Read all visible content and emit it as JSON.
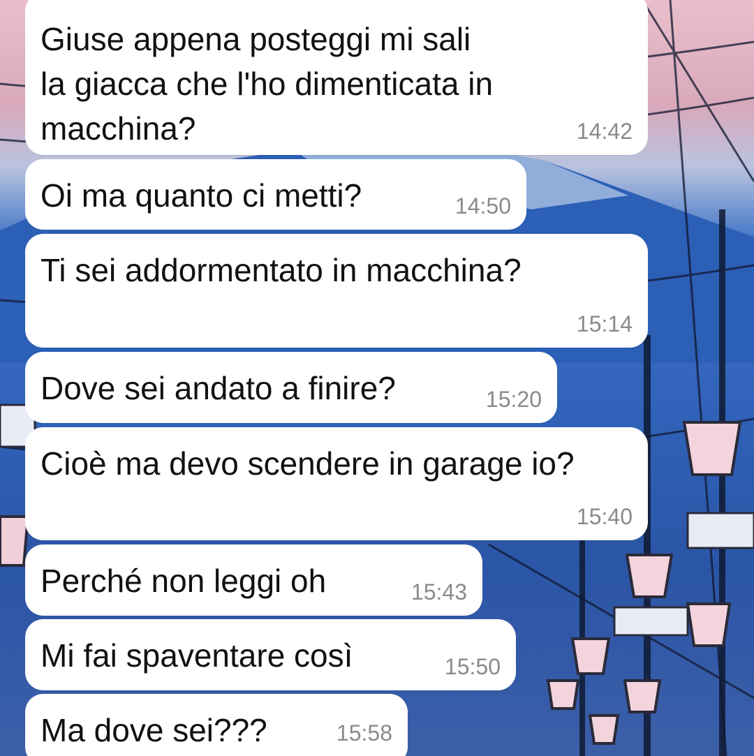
{
  "messages": [
    {
      "text": "Giuse appena posteggi mi sali\nla giacca che l'ho dimenticata in\nmacchina?",
      "time": "14:42"
    },
    {
      "text": "Oi ma quanto ci metti?",
      "time": "14:50"
    },
    {
      "text": "Ti sei addormentato in macchina?",
      "time": "15:14"
    },
    {
      "text": "Dove sei andato a finire?",
      "time": "15:20"
    },
    {
      "text": "Cioè ma devo scendere in garage io?",
      "time": "15:40"
    },
    {
      "text": "Perché non leggi oh",
      "time": "15:43"
    },
    {
      "text": "Mi fai spaventare così",
      "time": "15:50"
    },
    {
      "text": "Ma dove sei???",
      "time": "15:58"
    }
  ],
  "colors": {
    "bubble": "#ffffff",
    "text": "#111111",
    "timestamp": "#8a8a8a",
    "wallpaper_sky": "#e9bfcb",
    "wallpaper_blue": "#2f62b8"
  }
}
